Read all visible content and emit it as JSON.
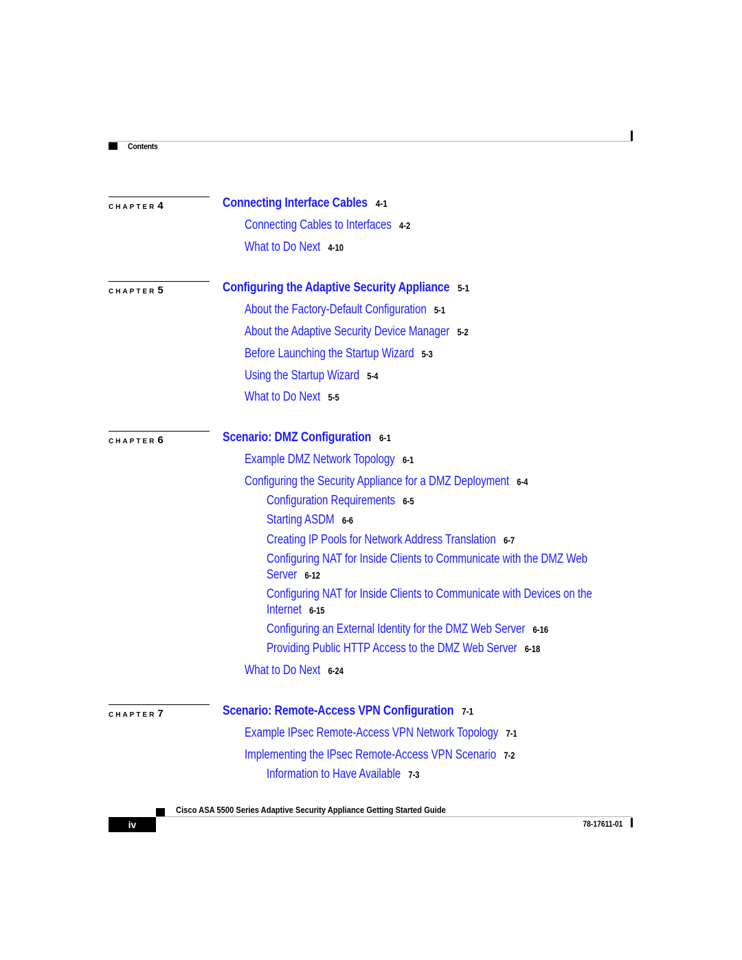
{
  "header": {
    "section_title": "Contents"
  },
  "colors": {
    "link": "#1a1aff",
    "text": "#000000",
    "rule": "#b0b0b0"
  },
  "chapter_word": "CHAPTER",
  "chapters": [
    {
      "number": "4",
      "title": "Connecting Interface Cables",
      "page": "4-1",
      "entries": [
        {
          "level": 1,
          "title": "Connecting Cables to Interfaces",
          "page": "4-2"
        },
        {
          "level": 1,
          "title": "What to Do Next",
          "page": "4-10"
        }
      ]
    },
    {
      "number": "5",
      "title": "Configuring the Adaptive Security Appliance",
      "page": "5-1",
      "entries": [
        {
          "level": 1,
          "title": "About the Factory-Default Configuration",
          "page": "5-1"
        },
        {
          "level": 1,
          "title": "About the Adaptive Security Device Manager",
          "page": "5-2"
        },
        {
          "level": 1,
          "title": "Before Launching the Startup Wizard",
          "page": "5-3"
        },
        {
          "level": 1,
          "title": "Using the Startup Wizard",
          "page": "5-4"
        },
        {
          "level": 1,
          "title": "What to Do Next",
          "page": "5-5"
        }
      ]
    },
    {
      "number": "6",
      "title": "Scenario: DMZ Configuration",
      "page": "6-1",
      "entries": [
        {
          "level": 1,
          "title": "Example DMZ Network Topology",
          "page": "6-1"
        },
        {
          "level": 1,
          "title": "Configuring the Security Appliance for a DMZ Deployment",
          "page": "6-4"
        },
        {
          "level": 2,
          "title": "Configuration Requirements",
          "page": "6-5"
        },
        {
          "level": 2,
          "title": "Starting ASDM",
          "page": "6-6"
        },
        {
          "level": 2,
          "title": "Creating IP Pools for Network Address Translation",
          "page": "6-7"
        },
        {
          "level": 2,
          "title": "Configuring NAT for Inside Clients to Communicate with the DMZ Web",
          "title_line2": "Server",
          "page": "6-12"
        },
        {
          "level": 2,
          "title": "Configuring NAT for Inside Clients to Communicate with Devices on the",
          "title_line2": "Internet",
          "page": "6-15"
        },
        {
          "level": 2,
          "title": "Configuring an External Identity for the DMZ Web Server",
          "page": "6-16"
        },
        {
          "level": 2,
          "title": "Providing Public HTTP Access to the DMZ Web Server",
          "page": "6-18"
        },
        {
          "level": 1,
          "title": "What to Do Next",
          "page": "6-24"
        }
      ]
    },
    {
      "number": "7",
      "title": "Scenario: Remote-Access VPN Configuration",
      "page": "7-1",
      "entries": [
        {
          "level": 1,
          "title": "Example IPsec Remote-Access VPN Network Topology",
          "page": "7-1"
        },
        {
          "level": 1,
          "title": "Implementing the IPsec Remote-Access VPN Scenario",
          "page": "7-2"
        },
        {
          "level": 2,
          "title": "Information to Have Available",
          "page": "7-3"
        }
      ]
    }
  ],
  "footer": {
    "page_number": "iv",
    "book_title": "Cisco ASA 5500 Series Adaptive Security Appliance Getting Started Guide",
    "doc_number": "78-17611-01"
  }
}
